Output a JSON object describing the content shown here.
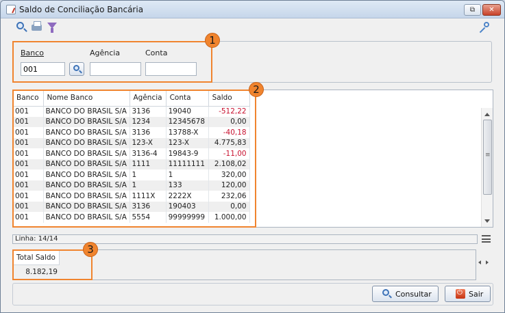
{
  "window": {
    "title": "Saldo de Conciliação Bancária",
    "restore_glyph": "⧉",
    "close_glyph": "✕"
  },
  "toolbar": {
    "icons": [
      "magnifier-icon",
      "printer-icon",
      "funnel-icon"
    ],
    "right_icon": "key-icon"
  },
  "filters": {
    "banco_label": "Banco",
    "banco_value": "001",
    "agencia_label": "Agência",
    "agencia_value": "",
    "conta_label": "Conta",
    "conta_value": ""
  },
  "grid": {
    "columns": [
      "Banco",
      "Nome Banco",
      "Agência",
      "Conta",
      "Saldo"
    ],
    "rows": [
      [
        "001",
        "BANCO DO BRASIL S/A",
        "3136",
        "19040",
        "-512,22"
      ],
      [
        "001",
        "BANCO DO BRASIL S/A",
        "1234",
        "12345678",
        "0,00"
      ],
      [
        "001",
        "BANCO DO BRASIL S/A",
        "3136",
        "13788-X",
        "-40,18"
      ],
      [
        "001",
        "BANCO DO BRASIL S/A",
        "123-X",
        "123-X",
        "4.775,83"
      ],
      [
        "001",
        "BANCO DO BRASIL S/A",
        "3136-4",
        "19843-9",
        "-11,00"
      ],
      [
        "001",
        "BANCO DO BRASIL S/A",
        "1111",
        "11111111",
        "2.108,02"
      ],
      [
        "001",
        "BANCO DO BRASIL S/A",
        "1",
        "1",
        "320,00"
      ],
      [
        "001",
        "BANCO DO BRASIL S/A",
        "1",
        "133",
        "120,00"
      ],
      [
        "001",
        "BANCO DO BRASIL S/A",
        "1111X",
        "2222X",
        "232,06"
      ],
      [
        "001",
        "BANCO DO BRASIL S/A",
        "3136",
        "190403",
        "0,00"
      ],
      [
        "001",
        "BANCO DO BRASIL S/A",
        "5554",
        "99999999",
        "1.000,00"
      ]
    ],
    "negative_color": "#c8102e"
  },
  "status": {
    "line_text": "Linha: 14/14"
  },
  "totals": {
    "header": "Total Saldo",
    "value": "8.182,19"
  },
  "buttons": {
    "consultar_label": "Consultar",
    "sair_label": "Sair"
  },
  "callouts": [
    "1",
    "2",
    "3"
  ],
  "colors": {
    "callout": "#f0842e"
  }
}
